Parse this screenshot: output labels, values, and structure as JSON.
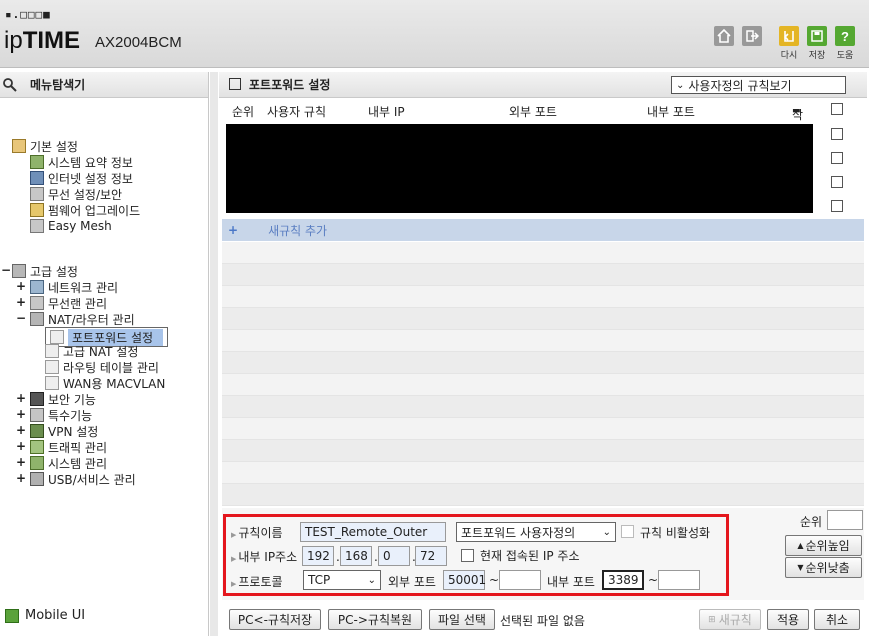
{
  "header": {
    "brand_dots": "▪.□□□■",
    "brand_prefix": "ip",
    "brand_bold": "TIME",
    "model": "AX2004BCM",
    "toolbar": {
      "exit_label": "다시",
      "save_label": "저장",
      "help_label": "도움"
    }
  },
  "sidebar": {
    "title": "메뉴탐색기",
    "basic": {
      "label": "기본 설정",
      "items": [
        "시스템 요약 정보",
        "인터넷 설정 정보",
        "무선 설정/보안",
        "펌웨어 업그레이드",
        "Easy Mesh"
      ]
    },
    "advanced": {
      "label": "고급 설정",
      "items": [
        "네트워크 관리",
        "무선랜 관리",
        "NAT/라우터 관리"
      ],
      "nat_children": [
        "포트포워드 설정",
        "고급 NAT 설정",
        "라우팅 테이블 관리",
        "WAN용 MACVLAN"
      ],
      "more_items": [
        "보안 기능",
        "특수기능",
        "VPN 설정",
        "트래픽 관리",
        "시스템 관리",
        "USB/서비스 관리"
      ]
    },
    "mobile_ui": "Mobile UI"
  },
  "main": {
    "title": "포트포워드 설정",
    "view_select": "사용자정의 규칙보기",
    "columns": {
      "order": "순위",
      "user_rule": "사용자 규칙",
      "internal_ip": "내부 IP",
      "external_port": "외부 포트",
      "internal_port": "내부 포트",
      "delete": "삭제"
    },
    "new_rule": "새규칙 추가"
  },
  "form": {
    "rule_name_label": "규칙이름",
    "rule_name_value": "TEST_Remote_Outer",
    "rule_type_value": "포트포워드 사용자정의",
    "disable_rule_label": "규칙 비활성화",
    "internal_ip_label": "내부 IP주소",
    "ip": [
      "192",
      "168",
      "0",
      "72"
    ],
    "current_ip_label": "현재 접속된 IP 주소",
    "protocol_label": "프로토콜",
    "protocol_value": "TCP",
    "external_port_label": "외부 포트",
    "external_port_from": "50001",
    "external_port_to": "",
    "internal_port_label": "내부 포트",
    "internal_port_from": "3389",
    "internal_port_to": "",
    "tilde": "~",
    "order_label": "순위",
    "order_value": "",
    "raise_button": "순위높임",
    "lower_button": "순위낮춤"
  },
  "bottom": {
    "backup_button": "PC<-규칙저장",
    "restore_button": "PC->규칙복원",
    "file_button": "파일 선택",
    "file_status": "선택된 파일 없음",
    "new_rule_button": "새규칙",
    "apply_button": "적용",
    "cancel_button": "취소"
  }
}
